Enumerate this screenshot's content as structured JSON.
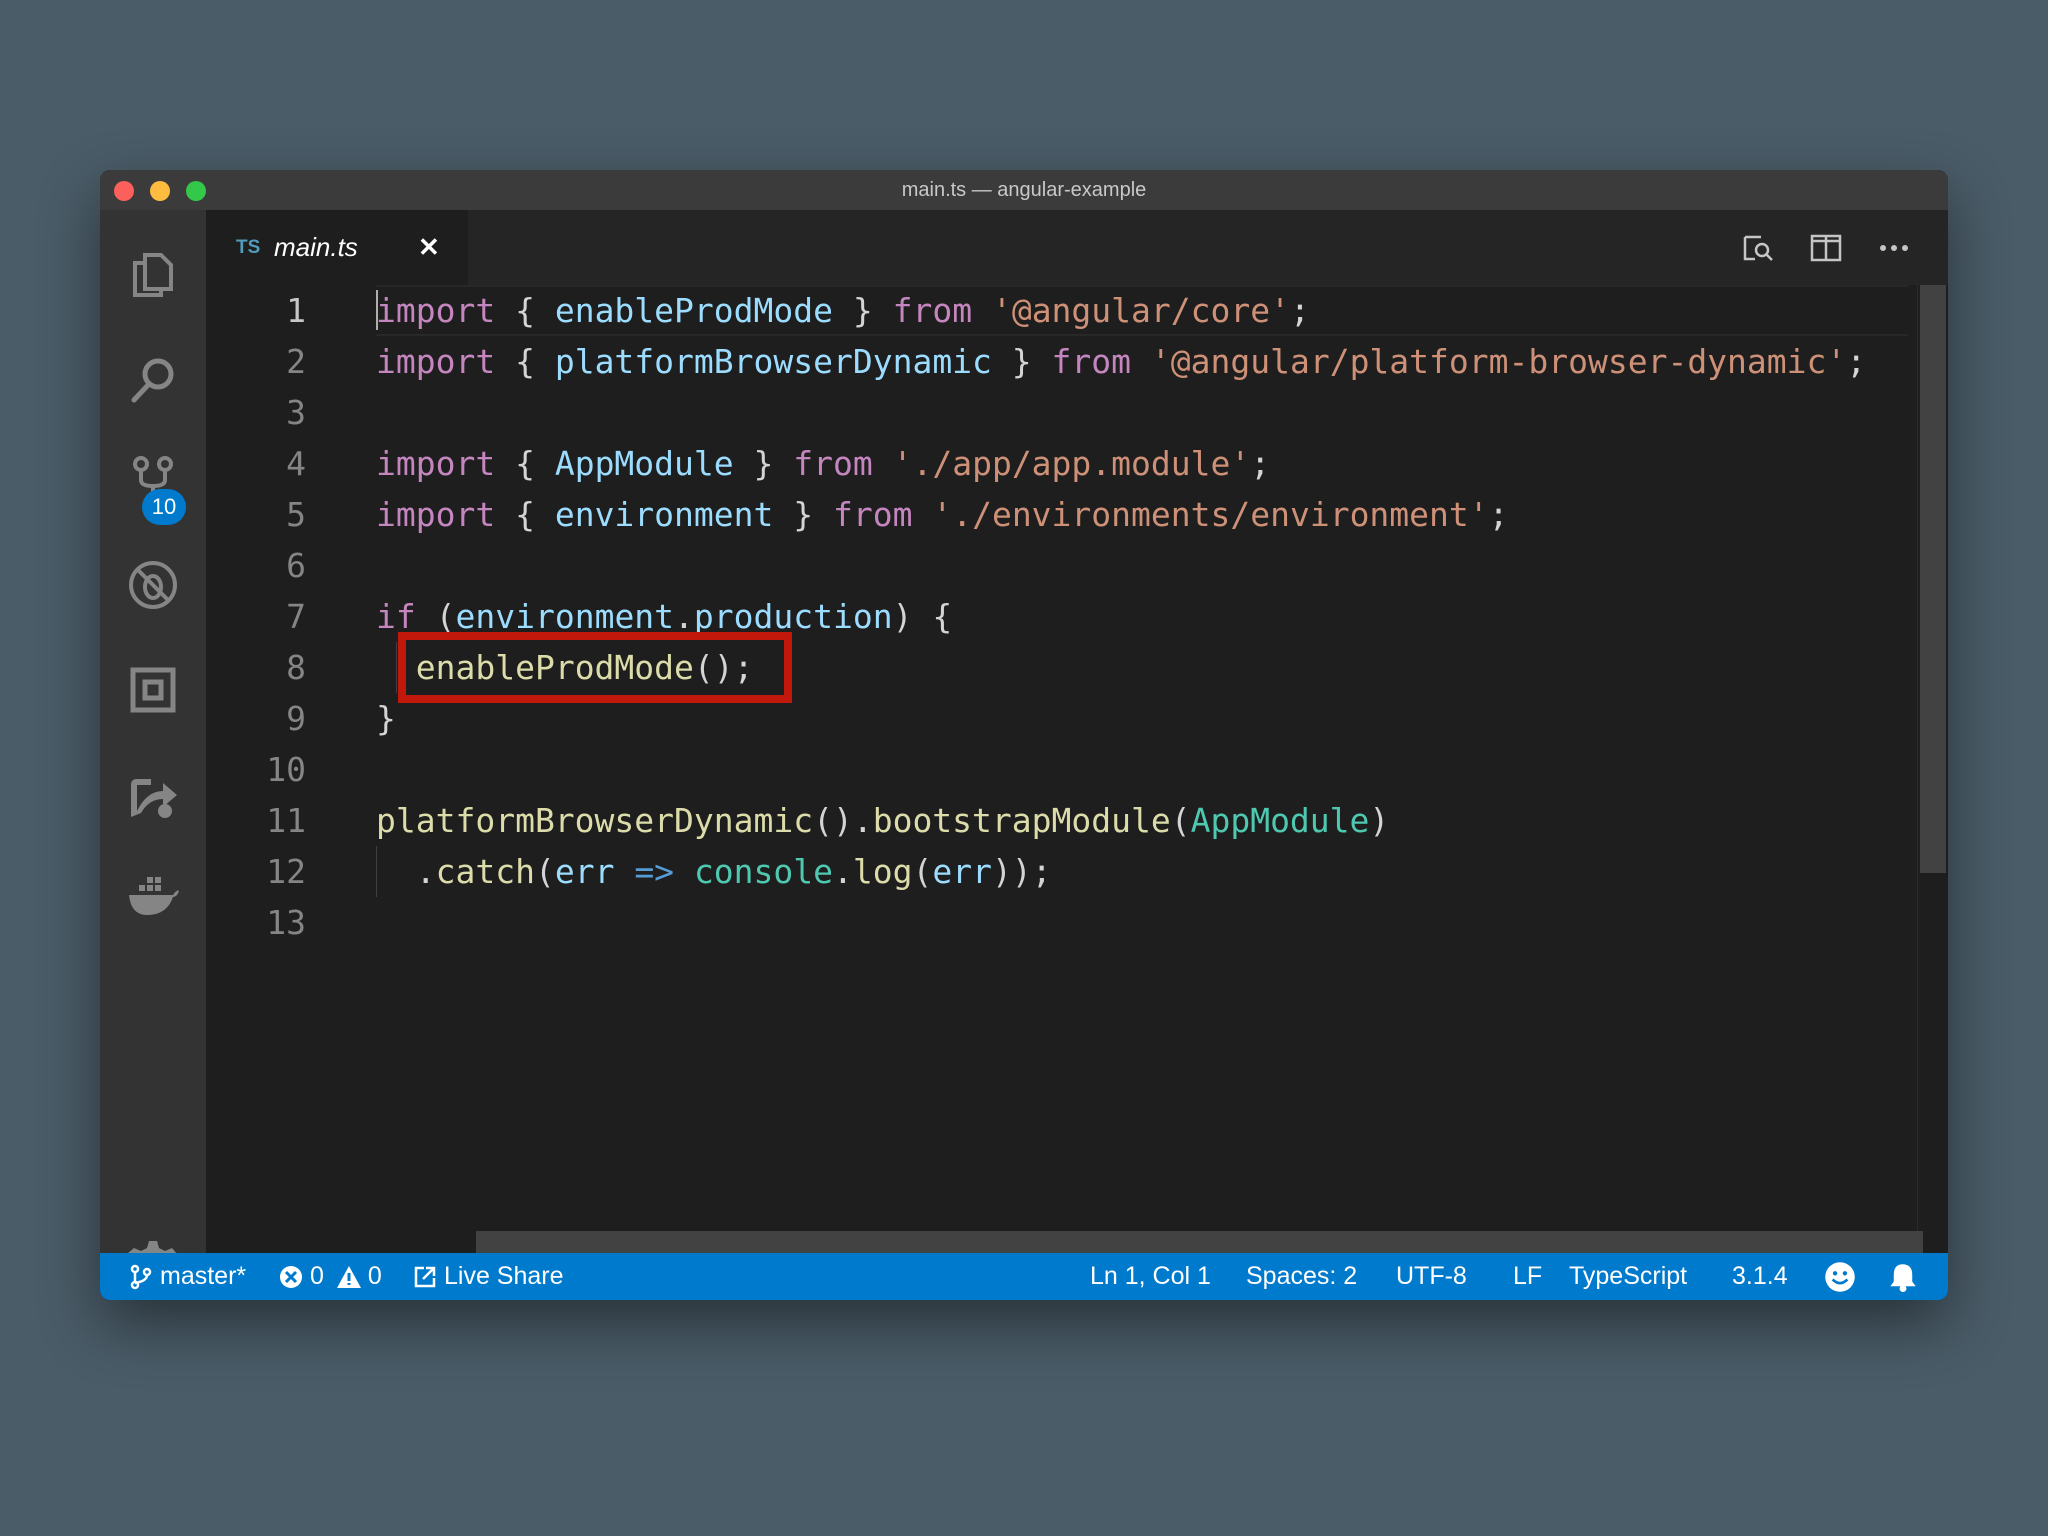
{
  "window": {
    "title": "main.ts — angular-example"
  },
  "activity_bar": {
    "items": [
      {
        "name": "explorer",
        "icon": "files-icon"
      },
      {
        "name": "search",
        "icon": "search-icon"
      },
      {
        "name": "source-control",
        "icon": "source-control-icon",
        "badge": "10"
      },
      {
        "name": "debug",
        "icon": "debug-icon"
      },
      {
        "name": "extensions",
        "icon": "extensions-icon"
      },
      {
        "name": "live-share",
        "icon": "live-share-icon"
      },
      {
        "name": "docker",
        "icon": "docker-icon"
      }
    ],
    "settings_icon": "gear-icon"
  },
  "tab": {
    "lang": "TS",
    "filename": "main.ts",
    "close": "✕"
  },
  "editor": {
    "line_numbers": [
      "1",
      "2",
      "3",
      "4",
      "5",
      "6",
      "7",
      "8",
      "9",
      "10",
      "11",
      "12",
      "13"
    ],
    "lines": [
      "import { enableProdMode } from '@angular/core';",
      "import { platformBrowserDynamic } from '@angular/platform-browser-dynamic';",
      "",
      "import { AppModule } from './app/app.module';",
      "import { environment } from './environments/environment';",
      "",
      "if (environment.production) {",
      "  enableProdMode();",
      "}",
      "",
      "platformBrowserDynamic().bootstrapModule(AppModule)",
      "  .catch(err => console.log(err));",
      ""
    ],
    "tokens": {
      "import": "import",
      "from": "from",
      "if": "if",
      "enableProdMode": "enableProdMode",
      "platformBrowserDynamic": "platformBrowserDynamic",
      "AppModule": "AppModule",
      "environment": "environment",
      "production": "production",
      "bootstrapModule": "bootstrapModule",
      "catch": "catch",
      "err": "err",
      "arrow": "=>",
      "console": "console",
      "log": "log",
      "str_core": "'@angular/core'",
      "str_pbd": "'@angular/platform-browser-dynamic'",
      "str_app": "'./app/app.module'",
      "str_env": "'./environments/environment'"
    },
    "highlighted_line": 8
  },
  "status_bar": {
    "branch": "master*",
    "errors": "0",
    "warnings": "0",
    "live_share": "Live Share",
    "position": "Ln 1, Col 1",
    "spaces": "Spaces: 2",
    "encoding": "UTF-8",
    "eol": "LF",
    "language": "TypeScript",
    "version": "3.1.4"
  },
  "colors": {
    "status_bar": "#007acc",
    "highlight_box": "#c2180c",
    "keyword": "#c586c0",
    "string": "#ce9178",
    "variable": "#9cdcfe",
    "function": "#dcdcaa"
  }
}
